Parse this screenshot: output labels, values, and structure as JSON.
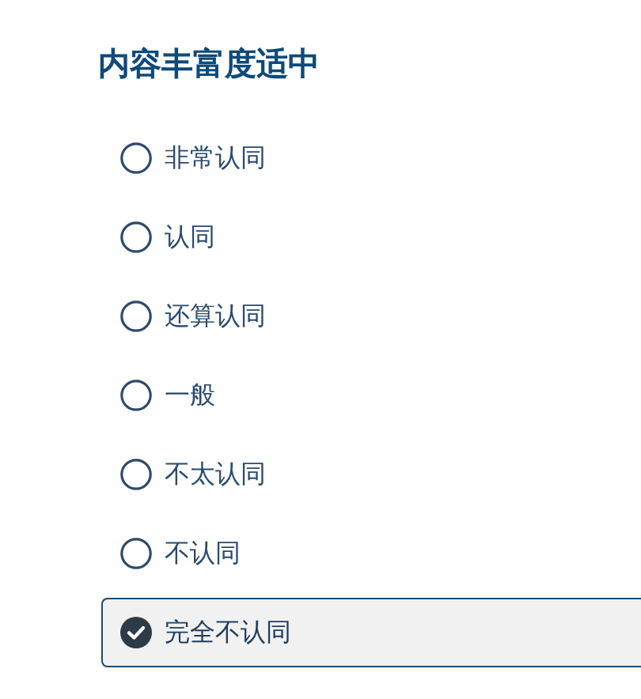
{
  "question": {
    "title": "内容丰富度适中",
    "options": [
      {
        "label": "非常认同",
        "selected": false
      },
      {
        "label": "认同",
        "selected": false
      },
      {
        "label": "还算认同",
        "selected": false
      },
      {
        "label": "一般",
        "selected": false
      },
      {
        "label": "不太认同",
        "selected": false
      },
      {
        "label": "不认同",
        "selected": false
      },
      {
        "label": "完全不认同",
        "selected": true
      }
    ]
  }
}
